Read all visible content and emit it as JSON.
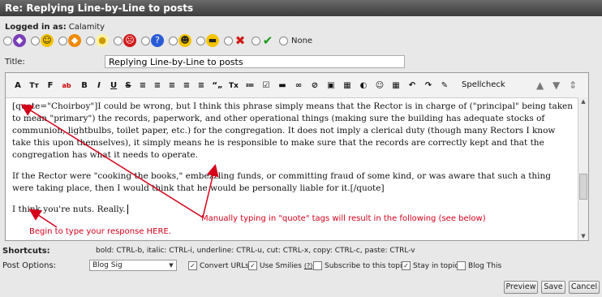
{
  "window": {
    "title": "Re: Replying Line-by-Line to posts"
  },
  "login": {
    "label": "Logged in as:",
    "user": "Calamity"
  },
  "post_icons": {
    "icons": [
      "purple-shield-icon",
      "smiley-icon",
      "orange-shield-icon",
      "lightbulb-icon",
      "angry-icon",
      "blue-shield-icon",
      "grin-icon",
      "cool-icon",
      "red-x-icon",
      "green-check-icon"
    ],
    "none_label": "None"
  },
  "title_field": {
    "label": "Title:",
    "value": "Replying Line-by-Line to posts"
  },
  "toolbar": {
    "buttons": [
      "A",
      "Tт",
      "F",
      "ab",
      "B",
      "I",
      "U",
      "S",
      "≡",
      "≡",
      "≡",
      "≡",
      "≡",
      "“„",
      "Tx",
      "≔",
      "☑",
      "▬",
      "∞",
      "⊘",
      "▣",
      "◐",
      "☺",
      "▦",
      "↶",
      "✎"
    ],
    "spellcheck_label": "Spellcheck"
  },
  "editor": {
    "p1": "[quote=\"Choirboy\"]I could be wrong, but I think this phrase simply means that the Rector is in charge of (\"principal\" being taken to mean \"primary\") the records, paperwork, and other operational things (making sure the building has adequate stocks of communion, lightbulbs, toilet paper, etc.) for the congregation. It does not imply a clerical duty (though many Rectors I know take this upon themselves), it simply means he is responsible to make sure that the records are correctly kept and that the congregation has what it needs to operate.",
    "p2": "If the Rector were \"cooking the books,\" embezzling funds, or committing fraud of some kind, or was aware that such a thing were taking place, then I would think that he would be personally liable for it.[/quote]",
    "p3": "I think you're nuts. Really."
  },
  "annotations": {
    "quote_note": "Manually typing in \"quote\" tags will result in the following (see below)",
    "response_note": "Begin to type your response HERE."
  },
  "shortcuts": {
    "label": "Shortcuts:",
    "text": "bold: CTRL-b, italic: CTRL-i, underline: CTRL-u, cut: CTRL-x, copy: CTRL-c, paste: CTRL-v"
  },
  "post_options": {
    "label": "Post Options:",
    "selected": "Blog Sig",
    "options": {
      "convert_urls": "Convert URLs",
      "use_smilies": "Use Smilies",
      "smilies_help": "(?)",
      "subscribe": "Subscribe to this topic",
      "stay_in_topic": "Stay in topic",
      "blog_this": "Blog This"
    }
  },
  "buttons": {
    "preview": "Preview",
    "save": "Save",
    "cancel": "Cancel"
  },
  "colors": {
    "annotation": "#d4001a",
    "titlebar": "#4a4a4a"
  }
}
